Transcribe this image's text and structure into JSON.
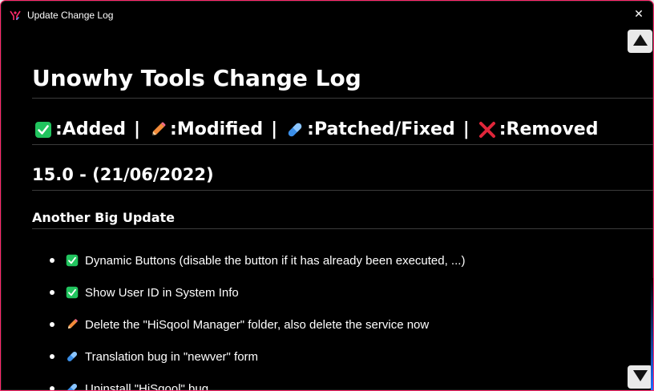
{
  "window": {
    "title": "Update Change Log",
    "close_glyph": "✕"
  },
  "content": {
    "heading": "Unowhy Tools Change Log",
    "legend": [
      {
        "icon": "check-mark-button-icon",
        "label": ":Added"
      },
      {
        "icon": "pencil-icon",
        "label": ":Modified"
      },
      {
        "icon": "pill-icon",
        "label": ":Patched/Fixed"
      },
      {
        "icon": "cross-mark-icon",
        "label": ":Removed"
      }
    ],
    "legend_separator": "|",
    "version": "15.0 - (21/06/2022)",
    "section_title": "Another Big Update",
    "items": [
      {
        "icon": "check-mark-button-icon",
        "text": "Dynamic Buttons (disable the button if it has already been executed, ...)"
      },
      {
        "icon": "check-mark-button-icon",
        "text": "Show User ID in System Info"
      },
      {
        "icon": "pencil-icon",
        "text": "Delete the \"HiSqool Manager\" folder, also delete the service now"
      },
      {
        "icon": "pill-icon",
        "text": "Translation bug in \"newver\" form"
      },
      {
        "icon": "pill-icon",
        "text": "Uninstall \"HiSqool\" bug"
      }
    ]
  },
  "scroll": {
    "up_icon": "arrow-up-icon",
    "down_icon": "arrow-down-icon"
  },
  "colors": {
    "window_bg": "#000000",
    "border_accent": "#ff2a6d",
    "added_green": "#21c45e",
    "modified_orange": "#f28b3a",
    "fixed_blue": "#3b8fe8",
    "removed_red": "#e0263a"
  }
}
